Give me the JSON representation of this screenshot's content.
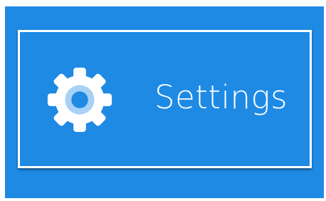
{
  "tile": {
    "label": "Settings",
    "icon": "gear-icon"
  },
  "colors": {
    "background": "#1e8ae4",
    "border": "#ffffff",
    "text": "#ffffff",
    "gear": "#ffffff",
    "gear_ring": "#a9d1f5",
    "gear_center": "#1e8ae4"
  }
}
